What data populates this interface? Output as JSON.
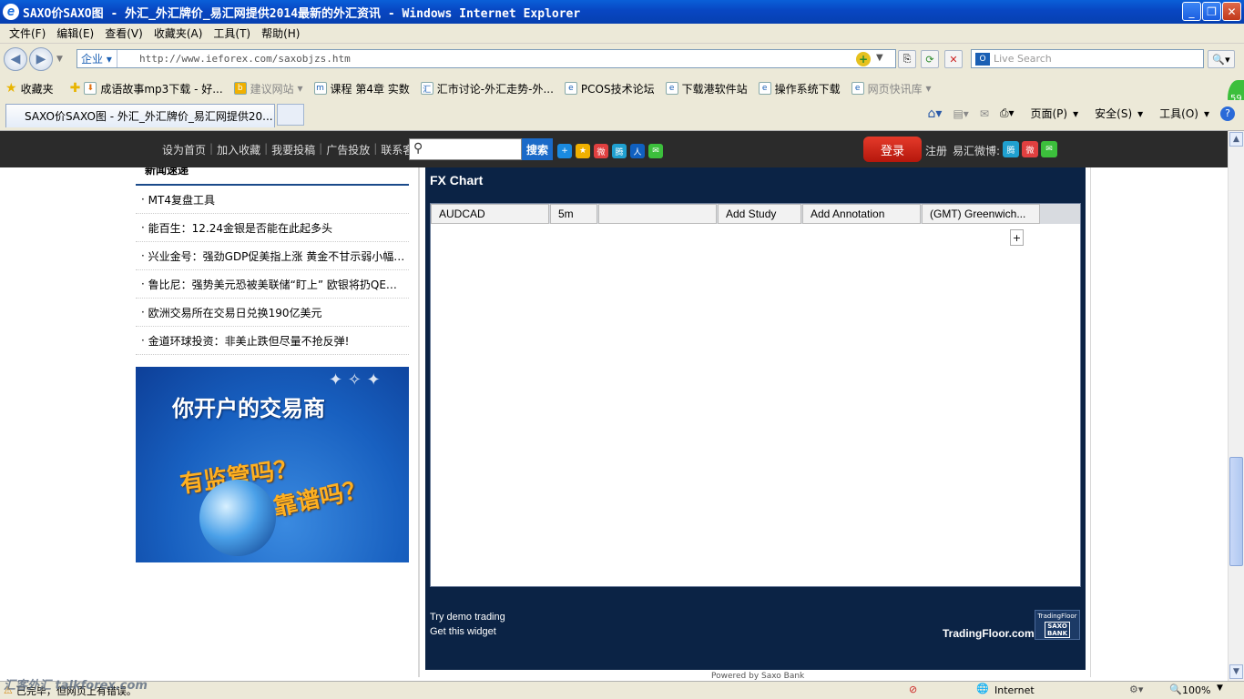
{
  "window": {
    "title": "SAXO价SAXO图 - 外汇_外汇牌价_易汇网提供2014最新的外汇资讯 - Windows Internet Explorer",
    "minimize": "_",
    "maximize": "❐",
    "close": "✕"
  },
  "menu": [
    "文件(F)",
    "编辑(E)",
    "查看(V)",
    "收藏夹(A)",
    "工具(T)",
    "帮助(H)"
  ],
  "address": {
    "zone": "企业",
    "url": "http://www.ieforex.com/saxobjzs.htm",
    "search_placeholder": "Live Search"
  },
  "favorites": {
    "label": "收藏夹",
    "items": [
      "成语故事mp3下载 - 好...",
      "建议网站",
      "课程 第4章 实数",
      "汇市讨论-外汇走势-外...",
      "PCOS技术论坛",
      "下载港软件站",
      "操作系统下载",
      "网页快讯库"
    ]
  },
  "tab": {
    "title": "SAXO价SAXO图 - 外汇_外汇牌价_易汇网提供20..."
  },
  "commands": [
    "页面(P)",
    "安全(S)",
    "工具(O)"
  ],
  "site_header": {
    "links": [
      "设为首页",
      "加入收藏",
      "我要投稿",
      "广告投放",
      "联系客服"
    ],
    "search_button": "搜索",
    "login": "登录",
    "register": "注册",
    "weibo": "易汇微博:"
  },
  "news": {
    "heading": "新闻速递",
    "items": [
      "MT4复盘工具",
      "能百生：12.24金银是否能在此起多头",
      "兴业金号：强劲GDP促美指上涨 黄金不甘示弱小幅…",
      "鲁比尼：强势美元恐被美联储“盯上” 欧银将扔QE…",
      "欧洲交易所在交易日兑换190亿美元",
      "金道环球投资：非美止跌但尽量不抢反弹!"
    ]
  },
  "ad": {
    "line1": "你开户的交易商",
    "line2": "有监管吗？",
    "line3": "靠谱吗？"
  },
  "fx": {
    "title": "FX Chart",
    "symbol": "AUDCAD",
    "interval": "5m",
    "add_study": "Add Study",
    "add_annotation": "Add Annotation",
    "timezone": "(GMT) Greenwich...",
    "plus": "+",
    "demo": "Try demo trading",
    "widget": "Get this widget",
    "brand": "TradingFloor.com",
    "badge_top": "TradingFloor",
    "badge_bottom": "SAXO BANK",
    "powered": "Powered by Saxo Bank"
  },
  "status": {
    "text": "已完毕，但网页上有错误。",
    "watermark": "汇客外汇 talkforex.com",
    "zone": "Internet",
    "zoom": "100%"
  }
}
